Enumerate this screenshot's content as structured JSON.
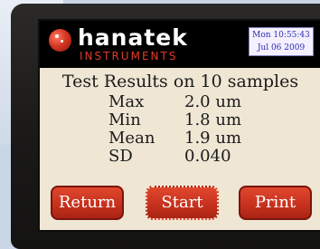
{
  "brand": {
    "name": "hanatek",
    "subtitle": "INSTRUMENTS"
  },
  "clock": {
    "line1": "Mon 10:55:43",
    "line2": "Jul 06 2009"
  },
  "title": "Test Results on 10 samples",
  "results": [
    {
      "label": "Max",
      "value": "2.0 um"
    },
    {
      "label": "Min",
      "value": "1.8 um"
    },
    {
      "label": "Mean",
      "value": "1.9 um"
    },
    {
      "label": "SD",
      "value": "0.040"
    }
  ],
  "buttons": {
    "return": "Return",
    "start": "Start",
    "print": "Print"
  }
}
